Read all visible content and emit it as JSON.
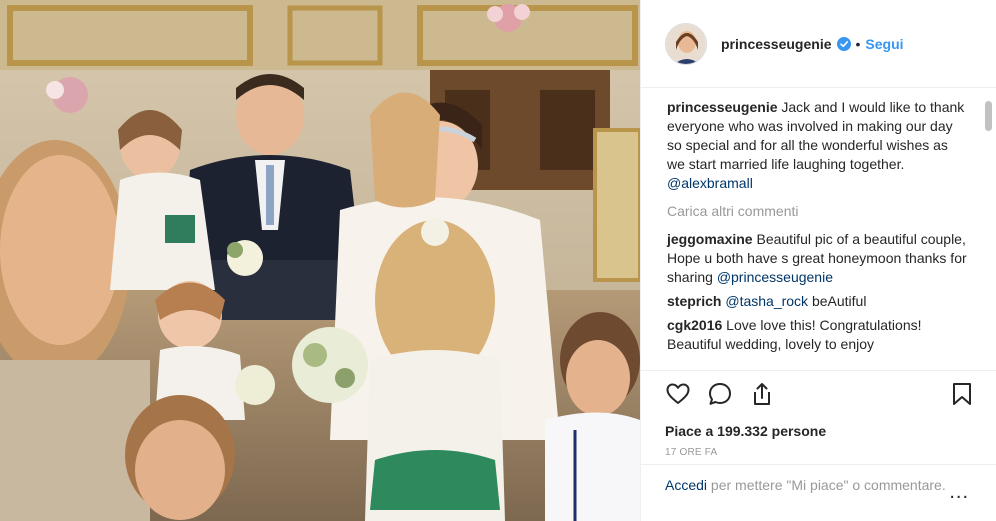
{
  "post": {
    "author": {
      "username": "princesseugenie",
      "follow_label": "Segui",
      "separator": "•"
    },
    "caption": {
      "username": "princesseugenie",
      "text": "Jack and I would like to thank everyone who was involved in making our day so special and for all the wonderful wishes as we start married life laughing together.",
      "mention": "@alexbramall"
    },
    "load_more_label": "Carica altri commenti",
    "comments": [
      {
        "username": "jeggomaxine",
        "text": "Beautiful pic of a beautiful couple, Hope u both have s great honeymoon thanks for sharing",
        "mention": "@princesseugenie",
        "after": ""
      },
      {
        "username": "steprich",
        "text": "",
        "mention": "@tasha_rock",
        "after": "beAutiful"
      },
      {
        "username": "cgk2016",
        "text": "Love love this! Congratulations! Beautiful wedding, lovely to enjoy",
        "mention": "",
        "after": ""
      }
    ],
    "icons": [
      "heart-icon",
      "comment-icon",
      "share-icon",
      "bookmark-icon"
    ],
    "likes_label": "Piace a 199.332 persone",
    "time_label": "17 ORE FA",
    "footer": {
      "login_label": "Accedi",
      "text": "per mettere \"Mi piace\" o commentare.",
      "more_label": "..."
    }
  },
  "colors": {
    "link": "#3897f0",
    "mention": "#003569",
    "muted": "#999999",
    "verified": "#3897f0"
  }
}
